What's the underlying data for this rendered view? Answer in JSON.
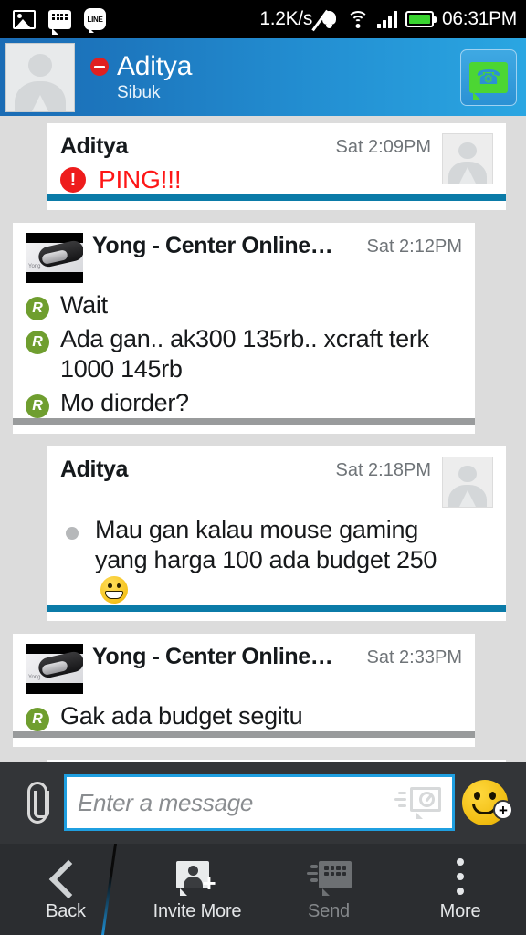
{
  "statusbar": {
    "notif_icons": [
      "photo-icon",
      "bbm-icon",
      "line-icon"
    ],
    "network_speed": "1.2K/s",
    "mute_icon": "mute-bell-icon",
    "wifi_icon": "wifi-icon",
    "signal_icon": "signal-bars-icon",
    "battery_icon": "battery-icon",
    "time": "06:31PM"
  },
  "header": {
    "avatar": "contact-avatar-placeholder",
    "presence_icon": "busy-status-dot",
    "name": "Aditya",
    "status": "Sibuk",
    "call_button_icon": "bbm-voice-call-icon",
    "accent_dark": "#1b6cb5",
    "accent_light": "#2aa6e2"
  },
  "chat": {
    "messages": [
      {
        "direction": "out",
        "sender": "Aditya",
        "time": "Sat 2:09PM",
        "avatar": "contact-avatar-placeholder",
        "ping": {
          "icon": "ping-alert-icon",
          "text": "PING!!!"
        },
        "lines": [],
        "underline_color": "#0b7ba8"
      },
      {
        "direction": "in",
        "sender": "Yong - Center Online…",
        "time": "Sat 2:12PM",
        "thumb": "fitness-band-photo",
        "lines": [
          {
            "badge": "R",
            "text": "Wait"
          },
          {
            "badge": "R",
            "text": "Ada gan.. ak300 135rb.. xcraft terk 1000 145rb"
          },
          {
            "badge": "R",
            "text": "Mo diorder?"
          }
        ],
        "underline_color": "#999b9c"
      },
      {
        "direction": "out",
        "sender": "Aditya",
        "time": "Sat 2:18PM",
        "avatar": "contact-avatar-placeholder",
        "lines": [
          {
            "badge": "dot",
            "text": "Mau gan kalau mouse gaming yang harga 100 ada budget 250 ",
            "emoji": "grinning-face"
          }
        ],
        "underline_color": "#0b7ba8"
      },
      {
        "direction": "in",
        "sender": "Yong - Center Online…",
        "time": "Sat 2:33PM",
        "thumb": "fitness-band-photo",
        "lines": [
          {
            "badge": "R",
            "text": "Gak ada budget segitu"
          }
        ],
        "underline_color": "#999b9c"
      }
    ]
  },
  "input": {
    "attach_icon": "paperclip-icon",
    "placeholder": "Enter a message",
    "value": "",
    "timed_message_icon": "timed-message-icon",
    "emoji_icon": "smiley-add-icon",
    "border_color": "#1f9fe0"
  },
  "navbar": {
    "items": [
      {
        "label": "Back",
        "icon": "chevron-left-icon",
        "disabled": false
      },
      {
        "label": "Invite More",
        "icon": "invite-person-add-icon",
        "disabled": false
      },
      {
        "label": "Send",
        "icon": "bbm-send-icon",
        "disabled": true
      },
      {
        "label": "More",
        "icon": "overflow-menu-icon",
        "disabled": false
      }
    ]
  }
}
